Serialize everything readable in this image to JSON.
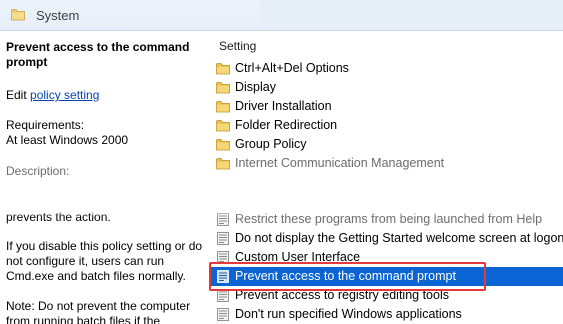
{
  "window": {
    "title": "System"
  },
  "details": {
    "setting_title": "Prevent access to the command prompt",
    "edit_prefix": "Edit",
    "edit_link": "policy setting",
    "requirements_label": "Requirements:",
    "requirements_value": "At least Windows 2000",
    "description_label": "Description:",
    "text_prevents": "prevents the action.",
    "text_disable": "If you disable this policy setting or do not configure it, users can run Cmd.exe and batch files normally.",
    "text_note": "Note: Do not prevent the computer from running batch files if the"
  },
  "list": {
    "column_header": "Setting",
    "folders": [
      "Ctrl+Alt+Del Options",
      "Display",
      "Driver Installation",
      "Folder Redirection",
      "Group Policy",
      "Internet Communication Management"
    ],
    "settings": [
      "Restrict these programs from being launched from Help",
      "Do not display the Getting Started welcome screen at logon",
      "Custom User Interface",
      "Prevent access to the command prompt",
      "Prevent access to registry editing tools",
      "Don't run specified Windows applications"
    ],
    "selected_setting": "Prevent access to the command prompt"
  },
  "colors": {
    "selection": "#0a64d4",
    "highlight_box": "#e23a3a",
    "link": "#0645ad",
    "title_bar": "#e6eef8"
  },
  "icons": {
    "folder": "folder-icon",
    "policy": "policy-setting-icon"
  }
}
